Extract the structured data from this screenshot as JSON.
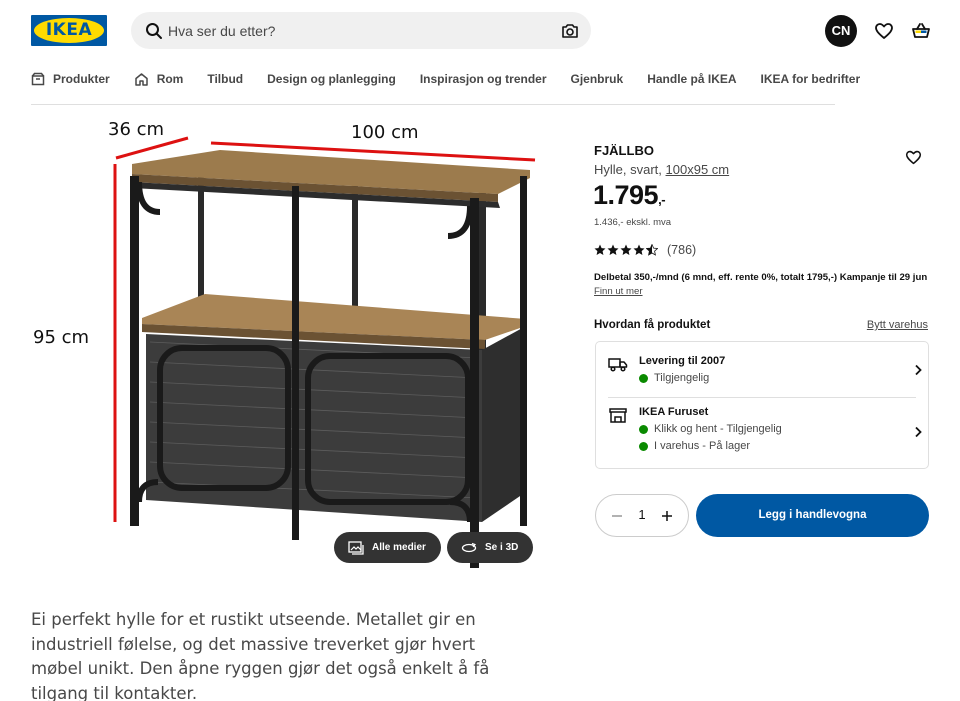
{
  "header": {
    "logo_text": "IKEA",
    "search_placeholder": "Hva ser du etter?",
    "avatar_initials": "CN"
  },
  "nav": {
    "items": [
      {
        "label": "Produkter",
        "icon": "box-icon"
      },
      {
        "label": "Rom",
        "icon": "house-icon"
      },
      {
        "label": "Tilbud"
      },
      {
        "label": "Design og planlegging"
      },
      {
        "label": "Inspirasjon og trender"
      },
      {
        "label": "Gjenbruk"
      },
      {
        "label": "Handle på IKEA"
      },
      {
        "label": "IKEA for bedrifter"
      }
    ]
  },
  "image": {
    "dim_depth": "36 cm",
    "dim_width": "100 cm",
    "dim_height": "95 cm",
    "all_media_label": "Alle medier",
    "view_3d_label": "Se i 3D"
  },
  "description": "Ei perfekt hylle for et rustikt utseende. Metallet gir en industriell følelse, og det massive treverket gjør hvert møbel unikt. Den åpne ryggen gjør det også enkelt å få tilgang til kontakter.",
  "product": {
    "name": "FJÄLLBO",
    "type": "Hylle, svart,",
    "size": "100x95 cm",
    "price": "1.795",
    "price_suffix": ",-",
    "price_ex_vat": "1.436,- ekskl. mva",
    "rating": 4.5,
    "rating_count": "(786)",
    "installment_text": "Delbetal 350,-/mnd (6 mnd, eff. rente 0%, totalt 1795,-) Kampanje til 29 jun",
    "installment_link": "Finn ut mer"
  },
  "delivery": {
    "title": "Hvordan få produktet",
    "change_store": "Bytt varehus",
    "options": [
      {
        "title": "Levering til 2007",
        "statuses": [
          "Tilgjengelig"
        ],
        "icon": "truck-icon"
      },
      {
        "title": "IKEA Furuset",
        "statuses": [
          "Klikk og hent - Tilgjengelig",
          "I varehus - På lager"
        ],
        "icon": "store-icon"
      }
    ],
    "status_color": "#0a8a00"
  },
  "cart": {
    "quantity": "1",
    "add_label": "Legg i handlevogna",
    "button_color": "#0058a3"
  }
}
